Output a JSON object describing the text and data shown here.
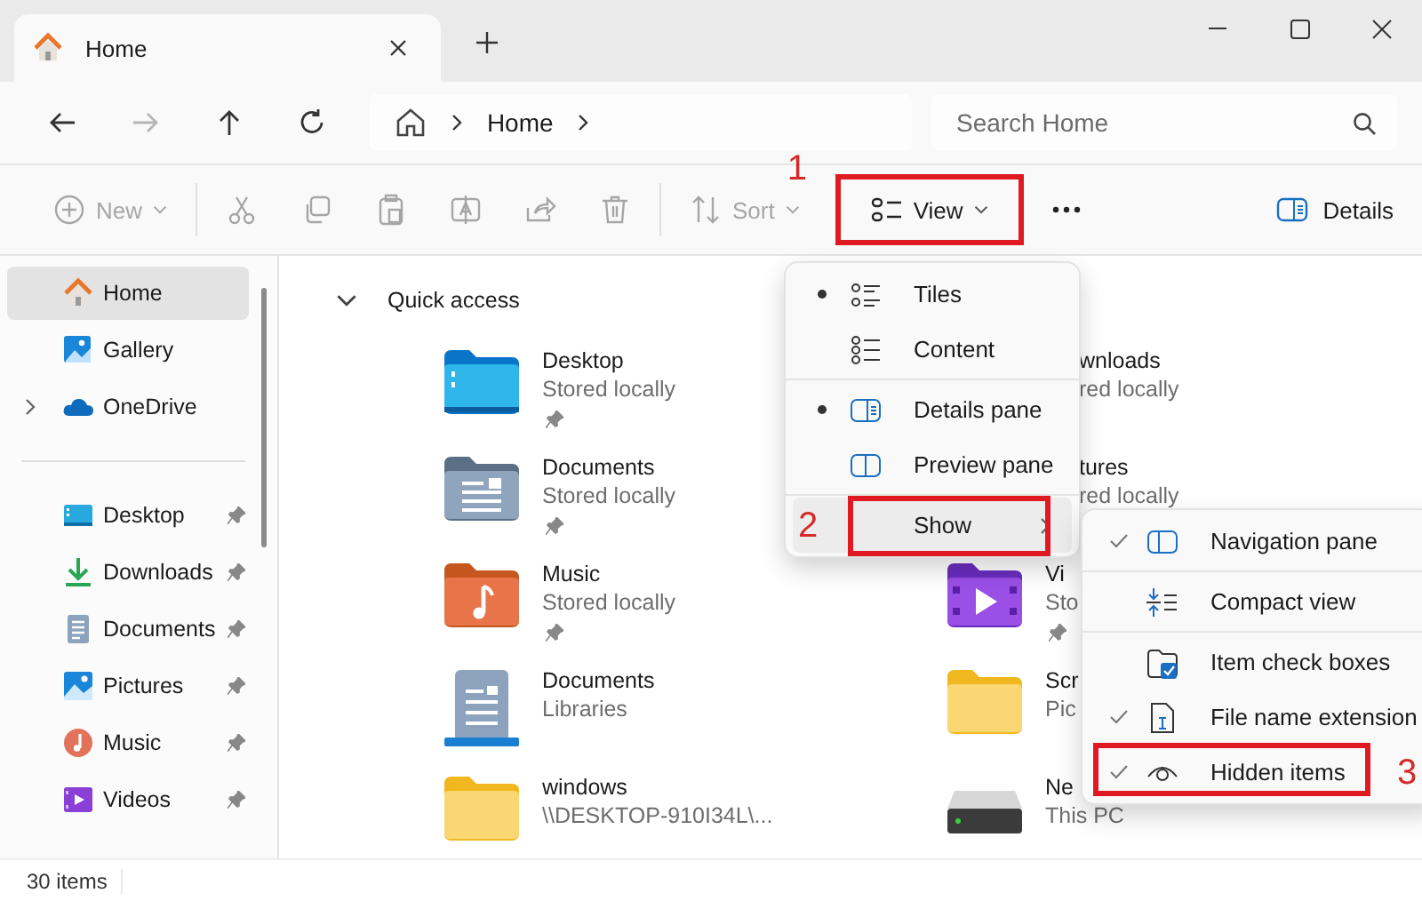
{
  "tab": {
    "title": "Home"
  },
  "address": {
    "breadcrumb": [
      "Home"
    ],
    "search": {
      "placeholder": "Search Home"
    }
  },
  "toolbar": {
    "items": [
      {
        "kind": "new",
        "label": "New",
        "disabled": true
      },
      {
        "kind": "cut",
        "disabled": true
      },
      {
        "kind": "copy",
        "disabled": true
      },
      {
        "kind": "paste",
        "disabled": true
      },
      {
        "kind": "rename",
        "disabled": true
      },
      {
        "kind": "share",
        "disabled": true
      },
      {
        "kind": "delete",
        "disabled": true
      },
      {
        "kind": "sort",
        "label": "Sort",
        "disabled": true
      },
      {
        "kind": "view",
        "label": "View",
        "disabled": false,
        "callout": "1"
      },
      {
        "kind": "more",
        "disabled": false
      }
    ],
    "details": {
      "label": "Details"
    }
  },
  "sidebar": {
    "items": [
      {
        "kind": "home",
        "label": "Home",
        "selected": true
      },
      {
        "kind": "gallery",
        "label": "Gallery",
        "selected": false
      },
      {
        "kind": "onedrive",
        "label": "OneDrive",
        "selected": false,
        "expanded": false
      },
      {
        "kind": "divider"
      },
      {
        "kind": "desktop",
        "label": "Desktop",
        "selected": false,
        "pinned": true
      },
      {
        "kind": "downloads",
        "label": "Downloads",
        "selected": false,
        "pinned": true
      },
      {
        "kind": "documents",
        "label": "Documents",
        "selected": false,
        "pinned": true
      },
      {
        "kind": "pictures",
        "label": "Pictures",
        "selected": false,
        "pinned": true
      },
      {
        "kind": "music",
        "label": "Music",
        "selected": false,
        "pinned": true
      },
      {
        "kind": "videos",
        "label": "Videos",
        "selected": false,
        "pinned": true
      }
    ]
  },
  "quick_access": {
    "title": "Quick access",
    "expanded": true,
    "items": [
      {
        "kind": "desktop",
        "name": "Desktop",
        "detail": "Stored locally",
        "pinned": true
      },
      {
        "name": "wnloads",
        "detail": "red locally"
      },
      {
        "kind": "documents",
        "name": "Documents",
        "detail": "Stored locally",
        "pinned": true
      },
      {
        "name": "tures",
        "detail": "red locally"
      },
      {
        "kind": "music",
        "name": "Music",
        "detail": "Stored locally",
        "pinned": true
      },
      {
        "kind": "videos",
        "name": "Vi",
        "detail": "Sto",
        "pinned": true
      },
      {
        "kind": "library",
        "name": "Documents",
        "detail": "Libraries"
      },
      {
        "kind": "folder",
        "name": "Scr",
        "detail": "Pic"
      },
      {
        "kind": "folder",
        "name": "windows",
        "detail": "\\\\DESKTOP-910I34L\\..."
      },
      {
        "kind": "drive",
        "name": "Ne",
        "detail": "This PC"
      }
    ]
  },
  "view_menu": {
    "items": [
      {
        "kind": "tiles",
        "label": "Tiles",
        "selected": true
      },
      {
        "kind": "content",
        "label": "Content",
        "selected": false
      },
      {
        "kind": "separator"
      },
      {
        "kind": "details-pane",
        "label": "Details pane",
        "selected": true
      },
      {
        "kind": "preview-pane",
        "label": "Preview pane",
        "selected": false
      },
      {
        "kind": "separator"
      },
      {
        "kind": "submenu",
        "label": "Show",
        "highlighted": true,
        "callout": "2"
      }
    ]
  },
  "show_menu": {
    "items": [
      {
        "kind": "navigation",
        "label": "Navigation pane",
        "checked": true
      },
      {
        "kind": "separator"
      },
      {
        "kind": "compact",
        "label": "Compact view",
        "checked": false
      },
      {
        "kind": "separator"
      },
      {
        "kind": "checkboxes",
        "label": "Item check boxes",
        "checked": false
      },
      {
        "kind": "extension",
        "label": "File name extension",
        "checked": true
      },
      {
        "kind": "hidden",
        "label": "Hidden items",
        "checked": true,
        "callout": "3"
      }
    ]
  },
  "status_bar": {
    "count": "30 items"
  }
}
